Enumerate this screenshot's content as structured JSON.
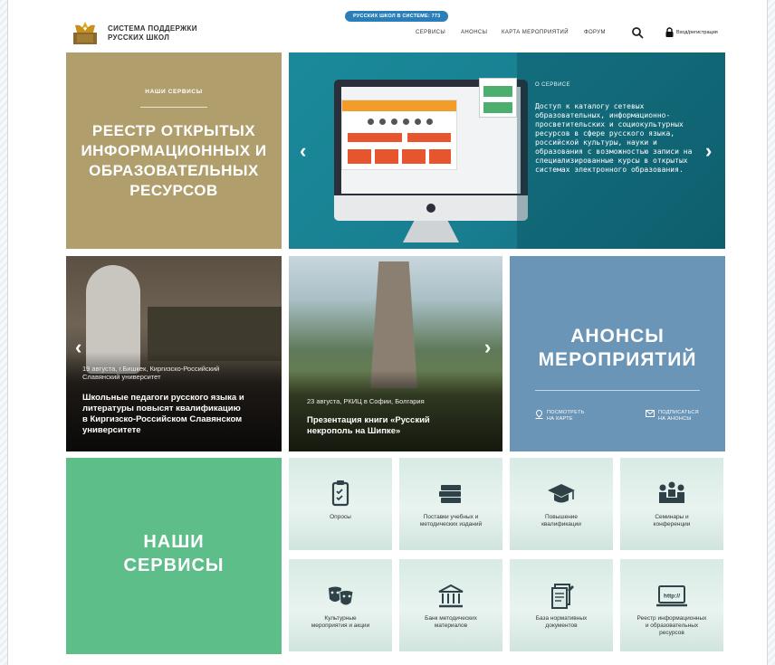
{
  "header": {
    "counter": "РУССКИХ ШКОЛ В СИСТЕМЕ: 773",
    "brand_line1": "СИСТЕМА ПОДДЕРЖКИ",
    "brand_line2": "РУССКИХ ШКОЛ",
    "nav": [
      "СЕРВИСЫ",
      "АНОНСЫ",
      "КАРТА МЕРОПРИЯТИЙ",
      "ФОРУМ"
    ],
    "login": "Вход/регистрация"
  },
  "registry": {
    "kicker": "НАШИ СЕРВИСЫ",
    "title_line1": "РЕЕСТР ОТКРЫТЫХ",
    "title_line2": "ИНФОРМАЦИОННЫХ И",
    "title_line3": "ОБРАЗОВАТЕЛЬНЫХ",
    "title_line4": "РЕСУРСОВ"
  },
  "hero": {
    "kicker": "О СЕРВИСЕ",
    "text": "Доступ к каталогу сетевых образовательных, информационно-просветительских и социокультурных ресурсов в сфере русского языка, российской культуры, науки и образования с возможностью записи на специализированные курсы в открытых системах электронного образования."
  },
  "news": [
    {
      "date_line1": "19 августа, г.Бишкек, Киргизско-Российский",
      "date_line2": "Славянский университет",
      "title_line1": "Школьные педагоги русского языка и",
      "title_line2": "литературы повысят квалификацию",
      "title_line3": "в Киргизско-Российском Славянском",
      "title_line4": "университете"
    },
    {
      "date_line1": "23 августа, РКИЦ в Софии, Болгария",
      "title_line1": "Презентация книги «Русский",
      "title_line2": "некрополь на Шипке»"
    }
  ],
  "anons": {
    "title_line1": "АНОНСЫ",
    "title_line2": "МЕРОПРИЯТИЙ",
    "map_line1": "ПОСМОТРЕТЬ",
    "map_line2": "НА КАРТЕ",
    "sub_line1": "ПОДПИСАТЬСЯ",
    "sub_line2": "НА АНОНСЫ"
  },
  "services": {
    "title_line1": "НАШИ",
    "title_line2": "СЕРВИСЫ",
    "items": [
      {
        "line1": "Опросы",
        "line2": "",
        "icon": "clipboard-icon"
      },
      {
        "line1": "Поставки учебных и",
        "line2": "методических изданий",
        "icon": "books-icon"
      },
      {
        "line1": "Повышение",
        "line2": "квалификации",
        "icon": "graduation-cap-icon"
      },
      {
        "line1": "Семинары и",
        "line2": "конференции",
        "icon": "seminar-icon"
      },
      {
        "line1": "Культурные",
        "line2": "мероприятия и акции",
        "icon": "theater-masks-icon"
      },
      {
        "line1": "Банк методических",
        "line2": "материалов",
        "icon": "bank-icon"
      },
      {
        "line1": "База нормативных",
        "line2": "документов",
        "icon": "documents-icon"
      },
      {
        "line1": "Реестр информационных",
        "line2": "и образовательных",
        "line3": "ресурсов",
        "icon": "http-monitor-icon"
      }
    ]
  },
  "colors": {
    "registry": "#b19e6d",
    "hero": "#1a8a9a",
    "anons": "#6b95b6",
    "services": "#5ebe8a",
    "counter": "#2a7fb8"
  }
}
